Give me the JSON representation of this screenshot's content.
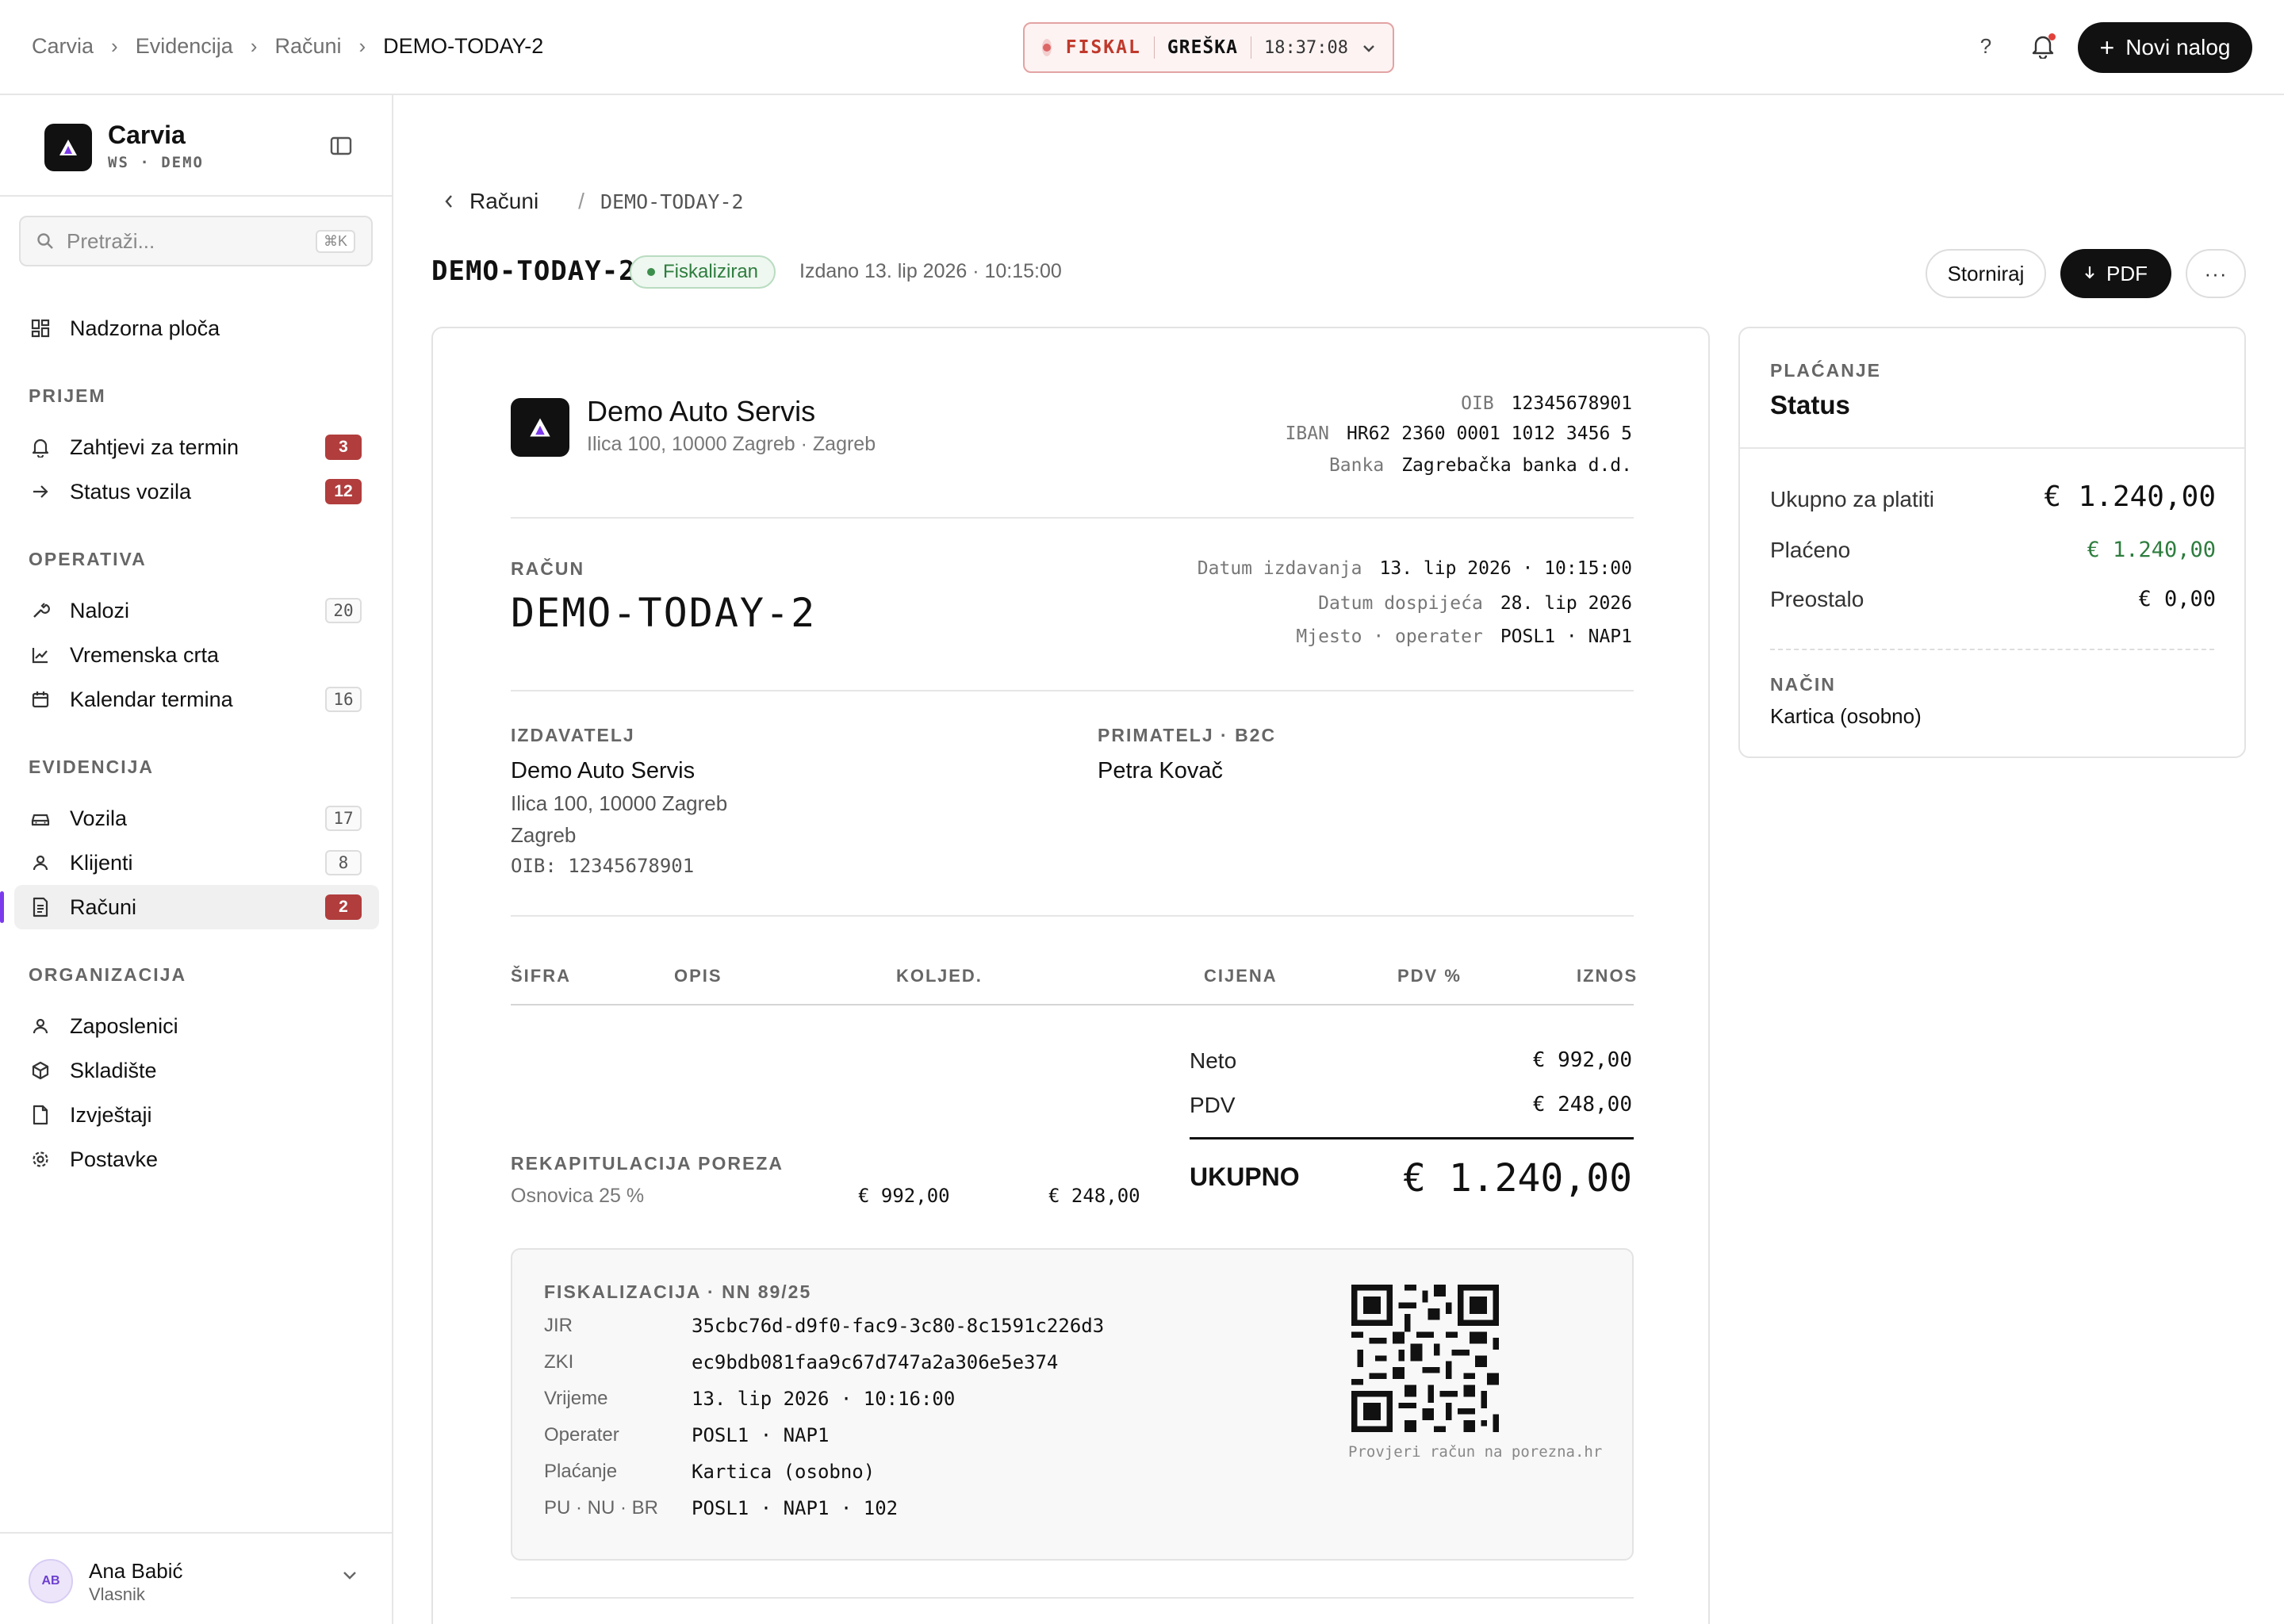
{
  "topbar": {
    "breadcrumbs": [
      "Carvia",
      "Evidencija",
      "Računi",
      "DEMO-TODAY-2"
    ],
    "fiskal": {
      "label": "FISKAL",
      "state": "GREŠKA",
      "time": "18:37:08"
    },
    "help": "?",
    "new_order": "Novi nalog"
  },
  "sidebar": {
    "brand": {
      "name": "Carvia",
      "sub": "WS · DEMO"
    },
    "search": {
      "placeholder": "Pretraži...",
      "shortcut": "⌘K"
    },
    "dashboard": "Nadzorna ploča",
    "sections": {
      "prijem": "PRIJEM",
      "operativa": "OPERATIVA",
      "evidencija": "EVIDENCIJA",
      "organizacija": "ORGANIZACIJA"
    },
    "items": {
      "zahtjevi": {
        "label": "Zahtjevi za termin",
        "count": "3"
      },
      "status_vozila": {
        "label": "Status vozila",
        "count": "12"
      },
      "nalozi": {
        "label": "Nalozi",
        "count": "20"
      },
      "vremenska": {
        "label": "Vremenska crta"
      },
      "kalendar": {
        "label": "Kalendar termina",
        "count": "16"
      },
      "vozila": {
        "label": "Vozila",
        "count": "17"
      },
      "klijenti": {
        "label": "Klijenti",
        "count": "8"
      },
      "racuni": {
        "label": "Računi",
        "count": "2"
      },
      "zaposlenici": {
        "label": "Zaposlenici"
      },
      "skladiste": {
        "label": "Skladište"
      },
      "izvjestaji": {
        "label": "Izvještaji"
      },
      "postavke": {
        "label": "Postavke"
      }
    },
    "user": {
      "initials": "AB",
      "name": "Ana Babić",
      "role": "Vlasnik"
    }
  },
  "page": {
    "back_label": "Računi",
    "back_doc": "DEMO-TODAY-2",
    "title": "DEMO-TODAY-2",
    "status": "Fiskaliziran",
    "issued": "Izdano 13. lip 2026 · 10:15:00",
    "actions": {
      "storno": "Storniraj",
      "pdf": "PDF",
      "more": "···"
    }
  },
  "invoice": {
    "company": {
      "name": "Demo Auto Servis",
      "address": "Ilica 100, 10000 Zagreb · Zagreb"
    },
    "company_ids": {
      "oib_k": "OIB",
      "oib_v": "12345678901",
      "iban_k": "IBAN",
      "iban_v": "HR62 2360 0001 1012 3456 5",
      "bank_k": "Banka",
      "bank_v": "Zagrebačka banka d.d."
    },
    "doc_label": "RAČUN",
    "doc_number": "DEMO-TODAY-2",
    "dates": {
      "issued_k": "Datum izdavanja",
      "issued_v": "13. lip 2026 · 10:15:00",
      "due_k": "Datum dospijeća",
      "due_v": "28. lip 2026",
      "place_k": "Mjesto · operater",
      "place_v": "POSL1 · NAP1"
    },
    "issuer": {
      "label": "IZDAVATELJ",
      "name": "Demo Auto Servis",
      "line1": "Ilica 100, 10000 Zagreb",
      "line2": "Zagreb",
      "oib": "OIB: 12345678901"
    },
    "recipient": {
      "label": "PRIMATELJ · B2C",
      "name": "Petra Kovač"
    },
    "columns": [
      "ŠIFRA",
      "OPIS",
      "KOL.",
      "JED.",
      "CIJENA",
      "PDV %",
      "IZNOS"
    ],
    "totals": {
      "neto_l": "Neto",
      "neto_v": "€ 992,00",
      "pdv_l": "PDV",
      "pdv_v": "€ 248,00",
      "total_l": "UKUPNO",
      "total_v": "€ 1.240,00"
    },
    "tax_recap": {
      "label": "REKAPITULACIJA POREZA",
      "row_label": "Osnovica 25 %",
      "base": "€ 992,00",
      "tax": "€ 248,00"
    },
    "fiscal": {
      "title": "FISKALIZACIJA · NN 89/25",
      "rows": [
        {
          "k": "JIR",
          "v": "35cbc76d-d9f0-fac9-3c80-8c1591c226d3"
        },
        {
          "k": "ZKI",
          "v": "ec9bdb081faa9c67d747a2a306e5e374"
        },
        {
          "k": "Vrijeme",
          "v": "13. lip 2026 · 10:16:00"
        },
        {
          "k": "Operater",
          "v": "POSL1 · NAP1"
        },
        {
          "k": "Plaćanje",
          "v": "Kartica (osobno)"
        },
        {
          "k": "PU · NU · BR",
          "v": "POSL1 · NAP1 · 102"
        }
      ],
      "qr_caption": "Provjeri račun na porezna.hr"
    }
  },
  "payment": {
    "eyebrow": "PLAĆANJE",
    "title": "Status",
    "total_l": "Ukupno za platiti",
    "total_v": "€ 1.240,00",
    "paid_l": "Plaćeno",
    "paid_v": "€ 1.240,00",
    "rest_l": "Preostalo",
    "rest_v": "€ 0,00",
    "method_label": "NAČIN",
    "method": "Kartica (osobno)"
  },
  "colors": {
    "accent": "#7c3aed",
    "error": "#c0392b",
    "success": "#2e7d3e",
    "badge_red": "#b13d3d",
    "primary_button": "#111111"
  }
}
